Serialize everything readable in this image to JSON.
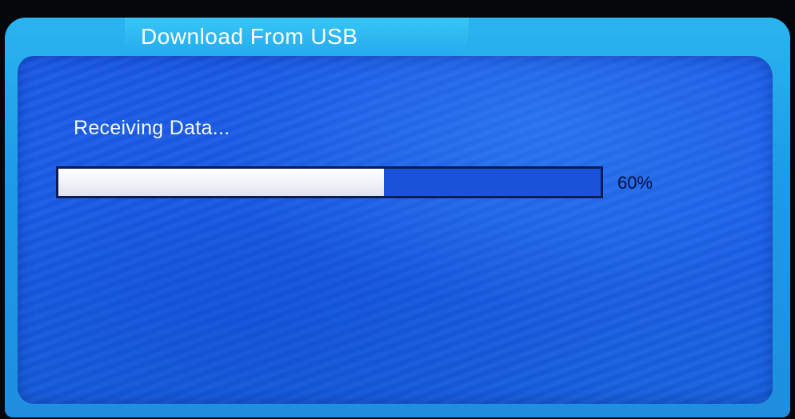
{
  "dialog": {
    "title": "Download From USB"
  },
  "status": {
    "message": "Receiving Data..."
  },
  "progress": {
    "value": 0.6,
    "percent_label": "60%"
  },
  "colors": {
    "frame": "#22a6ec",
    "body": "#1a59e6",
    "progress_fill": "#ffffff",
    "progress_border": "#0b1b55"
  }
}
